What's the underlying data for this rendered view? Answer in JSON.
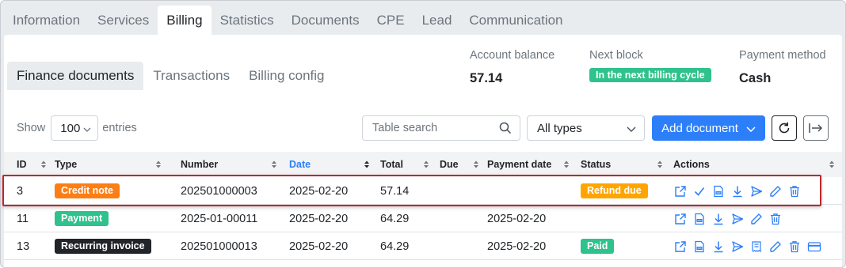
{
  "top_tabs": [
    {
      "label": "Information"
    },
    {
      "label": "Services"
    },
    {
      "label": "Billing",
      "active": true
    },
    {
      "label": "Statistics"
    },
    {
      "label": "Documents"
    },
    {
      "label": "CPE"
    },
    {
      "label": "Lead"
    },
    {
      "label": "Communication"
    }
  ],
  "sub_tabs": [
    {
      "label": "Finance documents",
      "active": true
    },
    {
      "label": "Transactions"
    },
    {
      "label": "Billing config"
    }
  ],
  "summary": {
    "balance_label": "Account balance",
    "balance_value": "57.14",
    "next_block_label": "Next block",
    "next_block_value": "In the next billing cycle",
    "payment_method_label": "Payment method",
    "payment_method_value": "Cash"
  },
  "controls": {
    "show_label": "Show",
    "entries_value": "100",
    "entries_label": "entries",
    "search_placeholder": "Table search",
    "type_filter_value": "All types",
    "add_document_label": "Add document"
  },
  "table": {
    "columns": [
      "ID",
      "Type",
      "Number",
      "Date",
      "Total",
      "Due",
      "Payment date",
      "Status",
      "Actions"
    ],
    "sorted_column": "Date",
    "rows": [
      {
        "id": "3",
        "type": "Credit note",
        "type_color": "#fd7e14",
        "number": "202501000003",
        "date": "2025-02-20",
        "total": "57.14",
        "due": "",
        "payment_date": "",
        "status": "Refund due",
        "status_color": "#ffa500",
        "actions": [
          "open-icon",
          "check-icon",
          "pdf-icon",
          "download-icon",
          "send-icon",
          "edit-icon",
          "delete-icon"
        ]
      },
      {
        "id": "11",
        "type": "Payment",
        "type_color": "#2fc28c",
        "number": "2025-01-00011",
        "date": "2025-02-20",
        "total": "64.29",
        "due": "",
        "payment_date": "2025-02-20",
        "status": "",
        "status_color": "",
        "actions": [
          "open-icon",
          "pdf-icon",
          "download-icon",
          "send-icon",
          "edit-icon",
          "delete-icon"
        ]
      },
      {
        "id": "13",
        "type": "Recurring invoice",
        "type_color": "#212529",
        "number": "202501000013",
        "date": "2025-02-20",
        "total": "64.29",
        "due": "",
        "payment_date": "2025-02-20",
        "status": "Paid",
        "status_color": "#2fc28c",
        "actions": [
          "open-icon",
          "pdf-icon",
          "download-icon",
          "send-icon",
          "receipt-icon",
          "edit-icon",
          "delete-icon",
          "credit-card-icon"
        ]
      }
    ]
  },
  "colors": {
    "accent": "#2d7ff9",
    "success": "#2fc28c",
    "highlight": "#c0262d"
  }
}
